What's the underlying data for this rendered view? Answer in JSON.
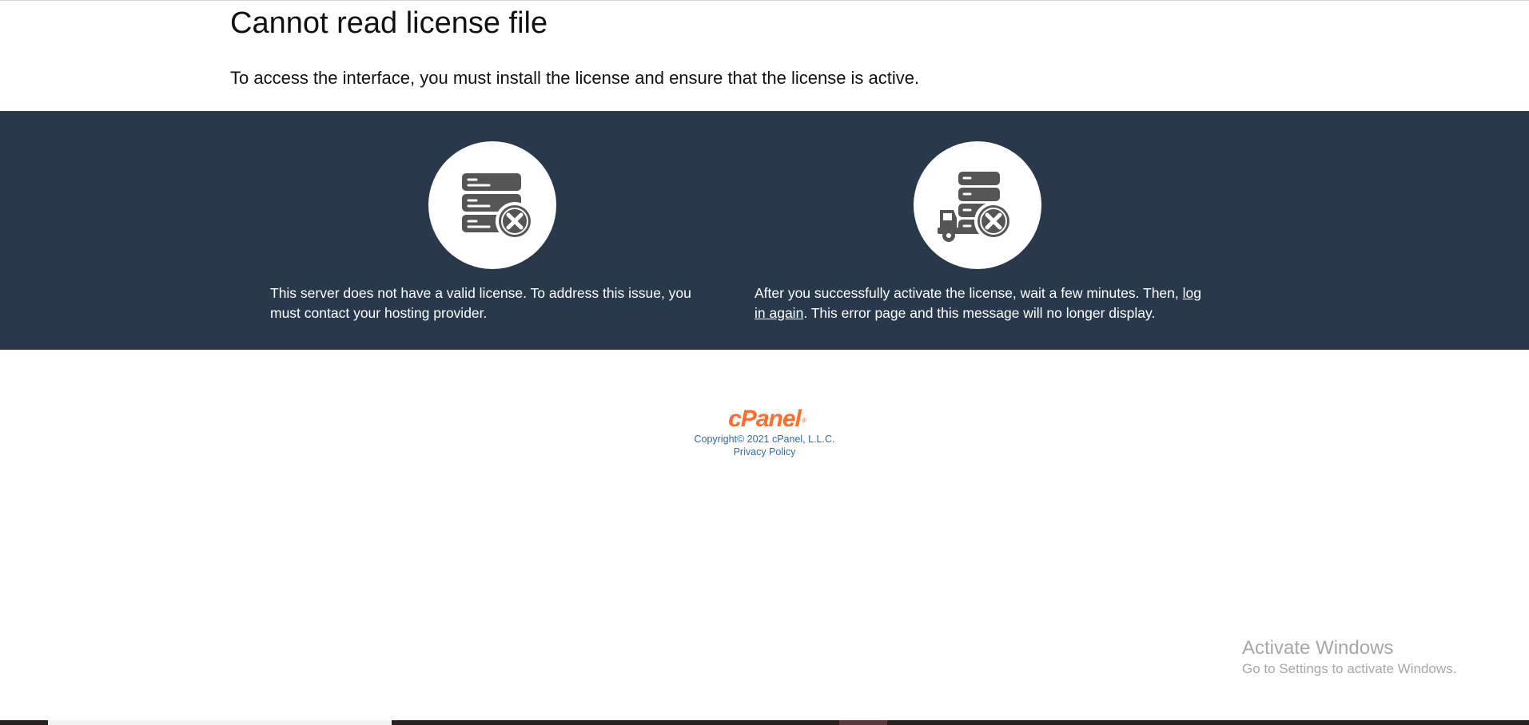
{
  "header": {
    "title": "Cannot read license file",
    "subtitle": "To access the interface, you must install the license and ensure that the license is active."
  },
  "cards": {
    "left": {
      "icon": "server-error-icon",
      "text": "This server does not have a valid license. To address this issue, you must contact your hosting provider."
    },
    "right": {
      "icon": "server-truck-error-icon",
      "text_before": "After you successfully activate the license, wait a few minutes. Then, ",
      "link": "log in again",
      "text_after": ". This error page and this message will no longer display."
    }
  },
  "footer": {
    "logo": "cPanel",
    "logo_mark": "®",
    "copyright": "Copyright© 2021 cPanel, L.L.C.",
    "privacy": "Privacy Policy"
  },
  "watermark": {
    "title": "Activate Windows",
    "subtitle": "Go to Settings to activate Windows."
  },
  "colors": {
    "band": "#29394b",
    "accent": "#ff6c2c",
    "link": "#2b6cb0",
    "icon": "#555555"
  }
}
